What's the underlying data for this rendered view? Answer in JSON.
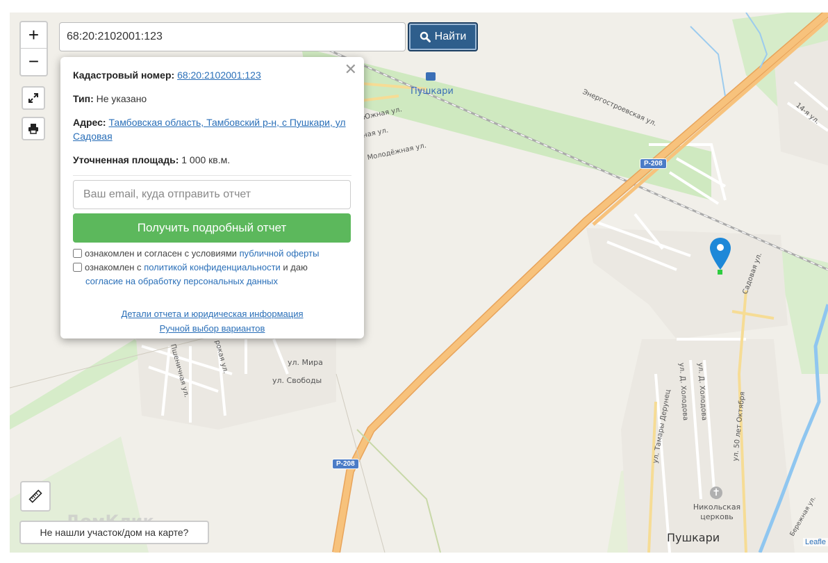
{
  "search": {
    "value": "68:20:2102001:123",
    "button_label": "Найти"
  },
  "zoom": {
    "in_label": "+",
    "out_label": "−"
  },
  "icons": {
    "fullscreen": "fullscreen-icon",
    "print": "print-icon",
    "ruler": "ruler-icon",
    "search": "search-icon",
    "pin": "map-pin-icon"
  },
  "popup": {
    "cadastral_label": "Кадастровый номер:",
    "cadastral_value": "68:20:2102001:123",
    "type_label": "Тип:",
    "type_value": "Не указано",
    "address_label": "Адрес:",
    "address_value": "Тамбовская область, Тамбовский р-н, с Пушкари, ул Садовая",
    "area_label": "Уточненная площадь:",
    "area_value": "1 000 кв.м.",
    "email_placeholder": "Ваш email, куда отправить отчет",
    "report_button": "Получить подробный отчет",
    "offer_text": "ознакомлен и согласен с условиями",
    "offer_link": "публичной оферты",
    "privacy_text": "ознакомлен с",
    "privacy_link": "политикой конфиденциальности",
    "privacy_and": "и даю",
    "consent_link": "согласие на обработку персональных данных",
    "details_link": "Детали отчета и юридическая информация",
    "manual_link": "Ручной выбор вариантов"
  },
  "map_labels": {
    "pushkari_station": "Пушкари",
    "energostroevskaya": "Энергостроевская ул.",
    "r208_a": "Р-208",
    "r208_b": "Р-208",
    "yuzhnaya": "Южная ул.",
    "naya": "ная ул.",
    "molodezhnaya": "Молодёжная ул.",
    "st14": "14-я ул.",
    "sadovaya": "Садовая ул.",
    "mira": "ул. Мира",
    "svobody": "ул. Свободы",
    "pshenichnaya": "Пшеничная ул.",
    "rokaya": "рокая ул.",
    "tamary": "ул. Тамары Дерунец",
    "holodova1": "ул. Д. Холодова",
    "holodova2": "ул. Д. Холодова",
    "oktyabrya": "ул. 50 лет Октября",
    "church": "Никольская церковь",
    "village": "Пушкари",
    "beregovaya": "Бережная ул.",
    "domklik": "ДомКлик"
  },
  "not_found_label": "Не нашли участок/дом на карте?",
  "attribution": "Leafle",
  "colors": {
    "find_button": "#2e5e8c",
    "report_button": "#5cb85c",
    "link": "#2a6fb8",
    "pin": "#1e88d8",
    "highway": "#f7c27c",
    "green_belt": "#c8e6b6"
  }
}
